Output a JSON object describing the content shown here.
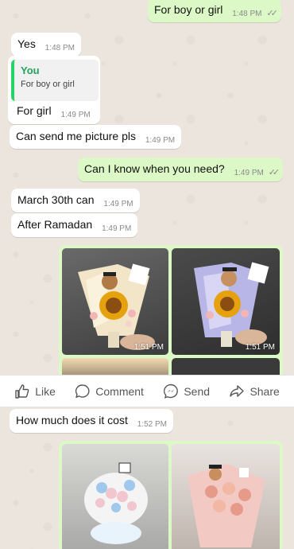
{
  "messages": {
    "m1": {
      "text": "For boy or girl",
      "time": "1:48 PM"
    },
    "m2": {
      "text": "Yes",
      "time": "1:48 PM"
    },
    "m3": {
      "quote_name": "You",
      "quote_text": "For boy or girl",
      "text": "For girl",
      "time": "1:49 PM"
    },
    "m4": {
      "text": "Can send me picture pls",
      "time": "1:49 PM"
    },
    "m5": {
      "text": "Can I know when you need?",
      "time": "1:49 PM"
    },
    "m6": {
      "text": "March 30th can",
      "time": "1:49 PM"
    },
    "m7": {
      "text": "After Ramadan",
      "time": "1:49 PM"
    },
    "photos_top": {
      "time_left": "1:51 PM",
      "time_right": "1:51 PM"
    },
    "m8": {
      "text": "How much does it cost",
      "time": "1:52 PM"
    }
  },
  "fb_actions": {
    "like": "Like",
    "comment": "Comment",
    "send": "Send",
    "share": "Share"
  },
  "colors": {
    "outgoing_bubble": "#dcf8c6",
    "incoming_bubble": "#ffffff",
    "chat_bg": "#ece5dd",
    "quote_accent": "#25d366"
  },
  "icons": [
    "double-check-icon",
    "like-icon",
    "comment-icon",
    "messenger-send-icon",
    "share-icon"
  ]
}
